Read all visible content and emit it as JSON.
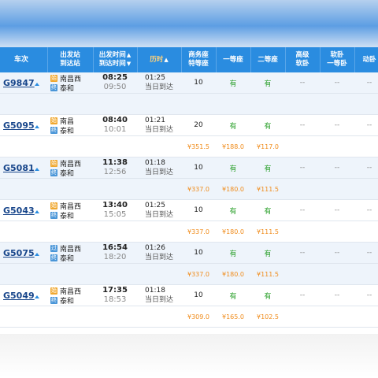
{
  "header": {
    "train": "车次",
    "from_to": [
      "出发站",
      "到达站"
    ],
    "times": [
      "出发时间",
      "到达时间"
    ],
    "duration": "历时",
    "business": [
      "商务座",
      "特等座"
    ],
    "first": "一等座",
    "second": "二等座",
    "deluxe_sleeper": [
      "高级",
      "软卧"
    ],
    "soft_sleeper": [
      "软卧",
      "一等卧"
    ],
    "moving_sleeper": "动卧",
    "sort_arrows": "▲▼"
  },
  "badges": {
    "start": "始",
    "pass": "过",
    "end": "终"
  },
  "trains": [
    {
      "no": "G9847",
      "from": "南昌西",
      "from_badge": "start",
      "to": "泰和",
      "to_badge": "end",
      "depart": "08:25",
      "arrive": "09:50",
      "duration": "01:25",
      "arrive_day": "当日到达",
      "business": "10",
      "first": "有",
      "second": "有",
      "other": [
        "--",
        "--",
        "--"
      ],
      "price_business": "",
      "price_first": "",
      "price_second": ""
    },
    {
      "no": "G5095",
      "from": "南昌",
      "from_badge": "start",
      "to": "泰和",
      "to_badge": "end",
      "depart": "08:40",
      "arrive": "10:01",
      "duration": "01:21",
      "arrive_day": "当日到达",
      "business": "20",
      "first": "有",
      "second": "有",
      "other": [
        "--",
        "--",
        "--"
      ],
      "price_business": "¥351.5",
      "price_first": "¥188.0",
      "price_second": "¥117.0"
    },
    {
      "no": "G5081",
      "from": "南昌西",
      "from_badge": "start",
      "to": "泰和",
      "to_badge": "end",
      "depart": "11:38",
      "arrive": "12:56",
      "duration": "01:18",
      "arrive_day": "当日到达",
      "business": "10",
      "first": "有",
      "second": "有",
      "other": [
        "--",
        "--",
        "--"
      ],
      "price_business": "¥337.0",
      "price_first": "¥180.0",
      "price_second": "¥111.5"
    },
    {
      "no": "G5043",
      "from": "南昌西",
      "from_badge": "start",
      "to": "泰和",
      "to_badge": "end",
      "depart": "13:40",
      "arrive": "15:05",
      "duration": "01:25",
      "arrive_day": "当日到达",
      "business": "10",
      "first": "有",
      "second": "有",
      "other": [
        "--",
        "--",
        "--"
      ],
      "price_business": "¥337.0",
      "price_first": "¥180.0",
      "price_second": "¥111.5"
    },
    {
      "no": "G5075",
      "from": "南昌西",
      "from_badge": "pass",
      "to": "泰和",
      "to_badge": "end",
      "depart": "16:54",
      "arrive": "18:20",
      "duration": "01:26",
      "arrive_day": "当日到达",
      "business": "10",
      "first": "有",
      "second": "有",
      "other": [
        "--",
        "--",
        "--"
      ],
      "price_business": "¥337.0",
      "price_first": "¥180.0",
      "price_second": "¥111.5"
    },
    {
      "no": "G5049",
      "from": "南昌西",
      "from_badge": "start",
      "to": "泰和",
      "to_badge": "end",
      "depart": "17:35",
      "arrive": "18:53",
      "duration": "01:18",
      "arrive_day": "当日到达",
      "business": "10",
      "first": "有",
      "second": "有",
      "other": [
        "--",
        "--",
        "--"
      ],
      "price_business": "¥309.0",
      "price_first": "¥165.0",
      "price_second": "¥102.5"
    }
  ]
}
